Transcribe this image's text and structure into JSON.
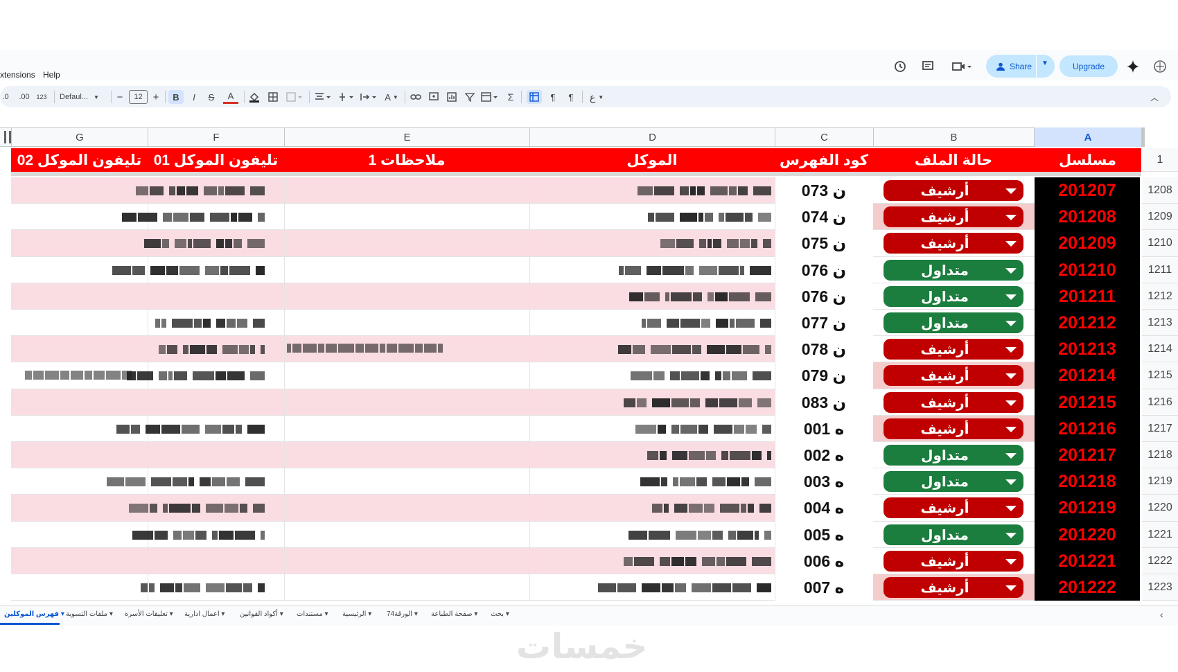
{
  "menu": {
    "extensions": "xtensions",
    "help": "Help"
  },
  "header_buttons": {
    "share": "Share",
    "upgrade": "Upgrade"
  },
  "toolbar": {
    "decrease_decimal": ".0",
    "increase_decimal": ".00",
    "number_format": "123",
    "font": "Defaul...",
    "font_size": "12",
    "bold": "B",
    "italic": "I",
    "strike": "S",
    "text_color": "A",
    "sum": "Σ"
  },
  "columns": [
    "G",
    "F",
    "E",
    "D",
    "C",
    "B",
    "A"
  ],
  "header_row": {
    "row_number": "1",
    "serial": "مسلسل",
    "status": "حالة الملف",
    "index_code": "كود الفهرس",
    "client": "الموكل",
    "notes": "ملاحظات 1",
    "phone1": "تليفون الموكل 01",
    "phone2": "تليفون الموكل 02"
  },
  "rows": [
    {
      "rownum": "1208",
      "serial": "201207",
      "status": "أرشيف",
      "code": "ن 073"
    },
    {
      "rownum": "1209",
      "serial": "201208",
      "status": "أرشيف",
      "code": "ن 074"
    },
    {
      "rownum": "1210",
      "serial": "201209",
      "status": "أرشيف",
      "code": "ن 075"
    },
    {
      "rownum": "1211",
      "serial": "201210",
      "status": "متداول",
      "code": "ن 076"
    },
    {
      "rownum": "1212",
      "serial": "201211",
      "status": "متداول",
      "code": "ن 076"
    },
    {
      "rownum": "1213",
      "serial": "201212",
      "status": "متداول",
      "code": "ن 077"
    },
    {
      "rownum": "1214",
      "serial": "201213",
      "status": "أرشيف",
      "code": "ن 078"
    },
    {
      "rownum": "1215",
      "serial": "201214",
      "status": "أرشيف",
      "code": "ن 079"
    },
    {
      "rownum": "1216",
      "serial": "201215",
      "status": "أرشيف",
      "code": "ن 083"
    },
    {
      "rownum": "1217",
      "serial": "201216",
      "status": "أرشيف",
      "code": "ه 001"
    },
    {
      "rownum": "1218",
      "serial": "201217",
      "status": "متداول",
      "code": "ه 002"
    },
    {
      "rownum": "1219",
      "serial": "201218",
      "status": "متداول",
      "code": "ه 003"
    },
    {
      "rownum": "1220",
      "serial": "201219",
      "status": "أرشيف",
      "code": "ه 004"
    },
    {
      "rownum": "1221",
      "serial": "201220",
      "status": "متداول",
      "code": "ه 005"
    },
    {
      "rownum": "1222",
      "serial": "201221",
      "status": "أرشيف",
      "code": "ه 006"
    },
    {
      "rownum": "1223",
      "serial": "201222",
      "status": "أرشيف",
      "code": "ه 007"
    }
  ],
  "sheet_tabs": [
    "فهرس الموكلين",
    "ملفات التسوية",
    "تعليقات الأسرة",
    "اعمال ادارية",
    "أكواد القوانين",
    "مستندات",
    "الرئيسية",
    "الورقة74",
    "صفحة الطباعة",
    "بحث"
  ],
  "watermark": "خمسات",
  "colors": {
    "header_red": "#ff0000",
    "archive_chip": "#c00000",
    "active_chip": "#1b7d3e",
    "row_pink": "#fadde3",
    "serial_bg": "#000000",
    "serial_text": "#ff0000"
  }
}
